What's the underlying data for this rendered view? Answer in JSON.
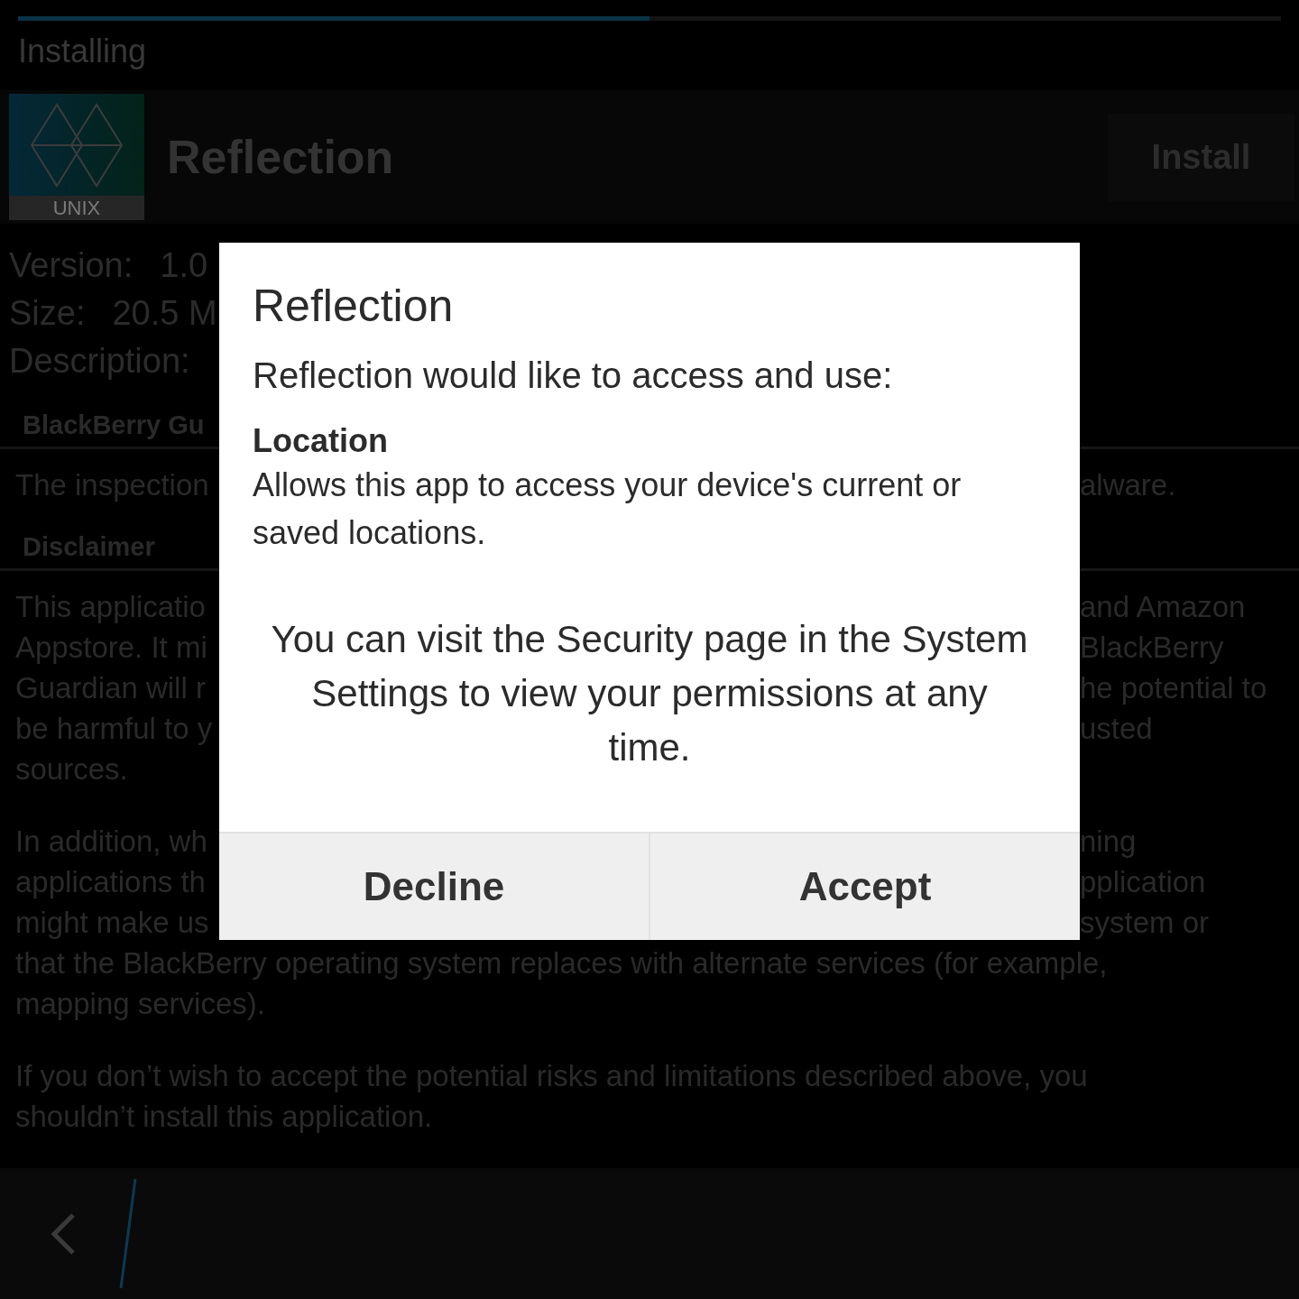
{
  "progress": {
    "level": 0.5
  },
  "status": "Installing",
  "app": {
    "icon_label": "UNIX",
    "name": "Reflection",
    "action": "Install"
  },
  "details": [
    {
      "label": "Version:",
      "value": "1.0"
    },
    {
      "label": "Size:",
      "value": "20.5 M"
    },
    {
      "label": "Description:"
    }
  ],
  "sections": [
    {
      "heading": "BlackBerry Gu",
      "paragraphs": [
        [
          {
            "left": "The inspection",
            "right": "alware."
          }
        ]
      ]
    },
    {
      "heading": "Disclaimer",
      "paragraphs": [
        [
          {
            "left": "This applicatio",
            "right": "and Amazon"
          },
          {
            "left": "Appstore. It mi",
            "right": "BlackBerry"
          },
          {
            "left": "Guardian will r",
            "right": "he potential to"
          },
          {
            "left": "be harmful to y",
            "right": "usted"
          },
          {
            "left": "sources."
          }
        ],
        [
          {
            "left": "In addition, wh",
            "right": "ning"
          },
          {
            "left": "applications th",
            "right": "pplication"
          },
          {
            "left": "might make us",
            "right": "system or"
          },
          {
            "full": "that the BlackBerry operating system replaces with alternate services (for example,"
          },
          {
            "full": "mapping services)."
          }
        ],
        [
          {
            "full": "If you don’t wish to accept the potential risks and limitations described above, you"
          },
          {
            "full": "shouldn’t install this application."
          }
        ]
      ]
    }
  ],
  "dialog": {
    "title": "Reflection",
    "intro": "Reflection would like to access and use:",
    "permissions": [
      {
        "name": "Location",
        "description": "Allows this app to access your device's current or saved locations."
      }
    ],
    "note": "You can visit the Security page in the System Settings to view your permissions at any time.",
    "buttons": [
      "Decline",
      "Accept"
    ]
  }
}
